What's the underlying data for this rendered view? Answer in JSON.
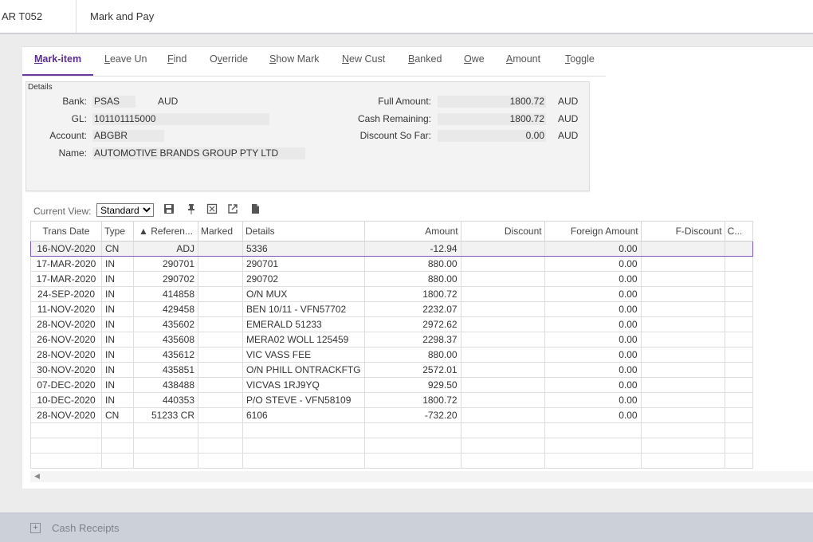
{
  "header": {
    "code": "AR T052",
    "title": "Mark and Pay"
  },
  "tabs": [
    {
      "first": "M",
      "rest": "ark-item"
    },
    {
      "first": "L",
      "rest": "eave Un"
    },
    {
      "first": "F",
      "rest": "ind"
    },
    {
      "first": "O",
      "rest": "verride",
      "u_index": 1
    },
    {
      "first": "S",
      "rest": "how Mark"
    },
    {
      "first": "N",
      "rest": "ew Cust"
    },
    {
      "first": "B",
      "rest": "anked"
    },
    {
      "first": "O",
      "rest": "we"
    },
    {
      "first": "A",
      "rest": "mount"
    },
    {
      "first": "T",
      "rest": "oggle"
    }
  ],
  "details": {
    "legend": "Details",
    "bank_label": "Bank:",
    "bank_value": "PSAS",
    "bank_currency": "AUD",
    "gl_label": "GL:",
    "gl_value": "101101115000",
    "account_label": "Account:",
    "account_value": "ABGBR",
    "name_label": "Name:",
    "name_value": "AUTOMOTIVE BRANDS GROUP PTY LTD",
    "full_amount_label": "Full Amount:",
    "full_amount_value": "1800.72",
    "full_amount_currency": "AUD",
    "cash_remaining_label": "Cash Remaining:",
    "cash_remaining_value": "1800.72",
    "cash_remaining_currency": "AUD",
    "discount_label": "Discount So Far:",
    "discount_value": "0.00",
    "discount_currency": "AUD"
  },
  "grid": {
    "current_view_label": "Current View:",
    "current_view_value": "Standard",
    "columns": [
      "Trans Date",
      "Type",
      "▲ Referen...",
      "Marked",
      "Details",
      "Amount",
      "Discount",
      "Foreign Amount",
      "F-Discount",
      "C..."
    ],
    "rows": [
      [
        "16-NOV-2020",
        "CN",
        "ADJ",
        "",
        "5336",
        "-12.94",
        "",
        "0.00",
        "",
        ""
      ],
      [
        "17-MAR-2020",
        "IN",
        "290701",
        "",
        "290701",
        "880.00",
        "",
        "0.00",
        "",
        ""
      ],
      [
        "17-MAR-2020",
        "IN",
        "290702",
        "",
        "290702",
        "880.00",
        "",
        "0.00",
        "",
        ""
      ],
      [
        "24-SEP-2020",
        "IN",
        "414858",
        "",
        "O/N MUX",
        "1800.72",
        "",
        "0.00",
        "",
        ""
      ],
      [
        "11-NOV-2020",
        "IN",
        "429458",
        "",
        "BEN 10/11 - VFN57702",
        "2232.07",
        "",
        "0.00",
        "",
        ""
      ],
      [
        "28-NOV-2020",
        "IN",
        "435602",
        "",
        "EMERALD 51233",
        "2972.62",
        "",
        "0.00",
        "",
        ""
      ],
      [
        "26-NOV-2020",
        "IN",
        "435608",
        "",
        "MERA02  WOLL 125459",
        "2298.37",
        "",
        "0.00",
        "",
        ""
      ],
      [
        "28-NOV-2020",
        "IN",
        "435612",
        "",
        "VIC VASS FEE",
        "880.00",
        "",
        "0.00",
        "",
        ""
      ],
      [
        "30-NOV-2020",
        "IN",
        "435851",
        "",
        "O/N PHILL ONTRACKFTG",
        "2572.01",
        "",
        "0.00",
        "",
        ""
      ],
      [
        "07-DEC-2020",
        "IN",
        "438488",
        "",
        "VICVAS 1RJ9YQ",
        "929.50",
        "",
        "0.00",
        "",
        ""
      ],
      [
        "10-DEC-2020",
        "IN",
        "440353",
        "",
        "P/O STEVE - VFN58109",
        "1800.72",
        "",
        "0.00",
        "",
        ""
      ],
      [
        "28-NOV-2020",
        "CN",
        "51233 CR",
        "",
        "6106",
        "-732.20",
        "",
        "0.00",
        "",
        ""
      ]
    ]
  },
  "footer": {
    "section_label": "Cash Receipts"
  }
}
